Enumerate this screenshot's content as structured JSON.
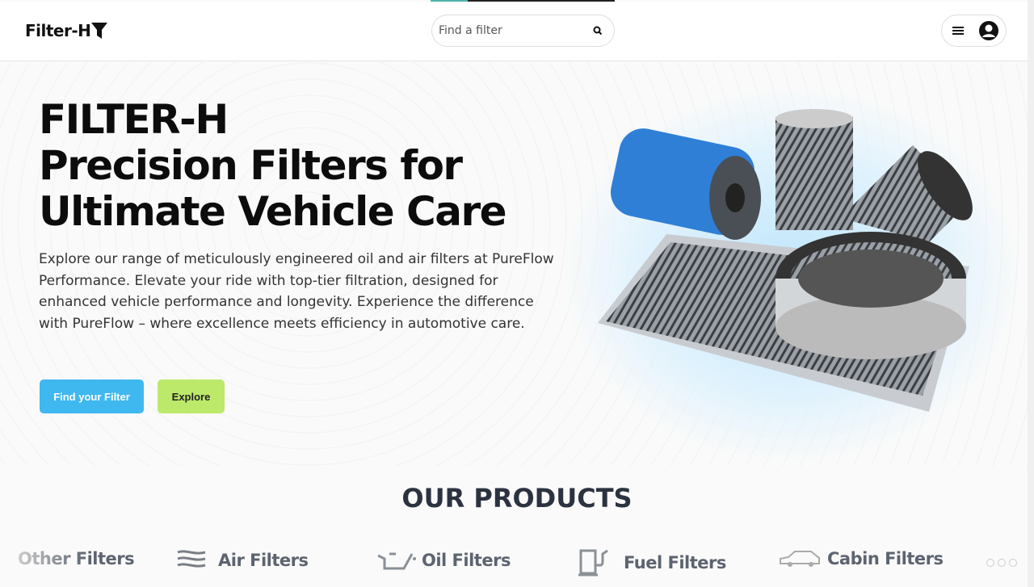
{
  "header": {
    "logo": "Filter-H",
    "search_placeholder": "Find a filter",
    "loading_progress": 0.2
  },
  "hero": {
    "title_line1": "FILTER-H",
    "title_line2": "Precision Filters for",
    "title_line3": "Ultimate Vehicle Care",
    "description": "Explore our range of meticulously engineered oil and air filters at PureFlow Performance. Elevate your ride with top-tier filtration, designed for enhanced vehicle performance and longevity. Experience the difference with PureFlow – where excellence meets efficiency in automotive care.",
    "find_button": "Find your Filter",
    "explore_button": "Explore"
  },
  "products": {
    "title": "OUR PRODUCTS",
    "categories": [
      {
        "label": "Other Filters",
        "icon": "none"
      },
      {
        "label": "Air Filters",
        "icon": "air-waves-icon"
      },
      {
        "label": "Oil Filters",
        "icon": "oil-can-icon"
      },
      {
        "label": "Fuel Filters",
        "icon": "fuel-pump-icon"
      },
      {
        "label": "Cabin Filters",
        "icon": "car-icon"
      }
    ]
  },
  "colors": {
    "primary_button": "#3fb8f0",
    "secondary_button": "#bde96a",
    "progress": "#4fb3a9"
  }
}
